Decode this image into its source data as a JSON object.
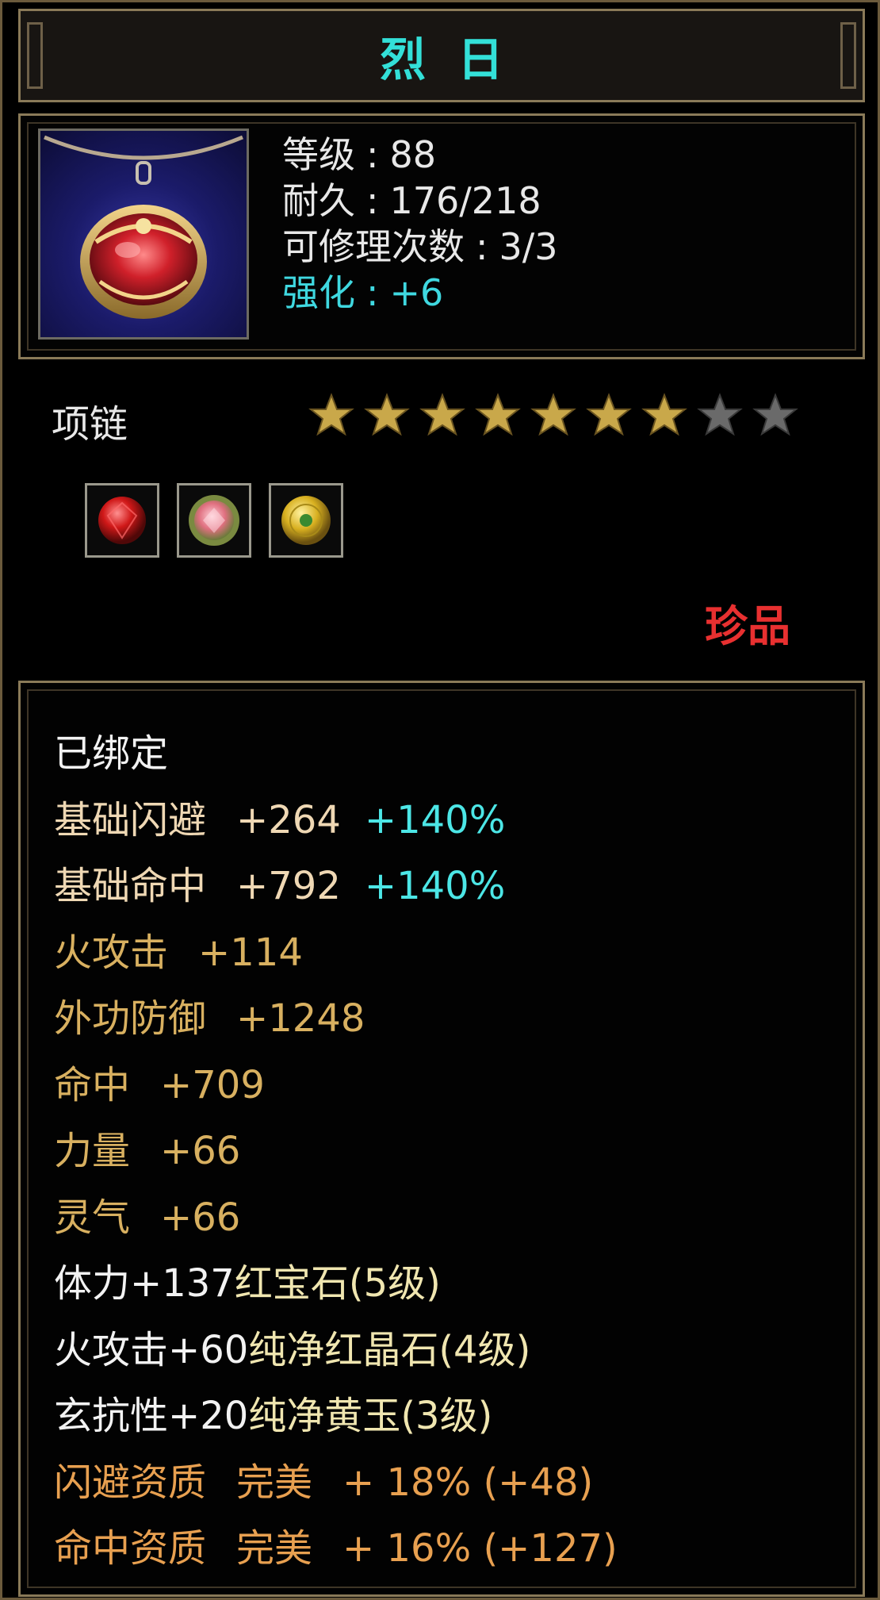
{
  "item": {
    "name": "烈日",
    "level_label": "等级",
    "level_value": "88",
    "durability_label": "耐久",
    "durability_value": "176/218",
    "repair_label": "可修理次数",
    "repair_value": "3/3",
    "enhance_label": "强化",
    "enhance_value": "+6",
    "sep": ":",
    "type": "项链",
    "stars_filled": 7,
    "stars_total": 9,
    "rarity": "珍品",
    "icon": "red-gem-necklace-icon",
    "gems": [
      {
        "icon": "ruby-gem-icon"
      },
      {
        "icon": "pink-crystal-gem-icon"
      },
      {
        "icon": "yellow-jade-gem-icon"
      }
    ]
  },
  "attributes": {
    "bound": "已绑定",
    "base_dodge": {
      "label": "基础闪避",
      "value": "+264",
      "bonus": "+140%"
    },
    "base_hit": {
      "label": "基础命中",
      "value": "+792",
      "bonus": "+140%"
    },
    "fire_attack": {
      "label": "火攻击",
      "value": "+114"
    },
    "outer_defense": {
      "label": "外功防御",
      "value": "+1248"
    },
    "hit": {
      "label": "命中",
      "value": "+709"
    },
    "strength": {
      "label": "力量",
      "value": "+66"
    },
    "spirit": {
      "label": "灵气",
      "value": "+66"
    },
    "gem_stat_1": {
      "stat": "体力+137",
      "gem": "红宝石(5级)"
    },
    "gem_stat_2": {
      "stat": "火攻击+60",
      "gem": "纯净红晶石(4级)"
    },
    "gem_stat_3": {
      "stat": "玄抗性+20",
      "gem": "纯净黄玉(3级)"
    },
    "aptitude_1": {
      "label": "闪避资质",
      "quality": "完美",
      "value": "+ 18% (+48)"
    },
    "aptitude_2": {
      "label": "命中资质",
      "quality": "完美",
      "value": "+ 16% (+127)"
    }
  },
  "colors": {
    "title": "#33e0d8",
    "rarity": "#e83030",
    "star_filled": "#c9a84a",
    "star_empty": "#6a6a6a"
  }
}
